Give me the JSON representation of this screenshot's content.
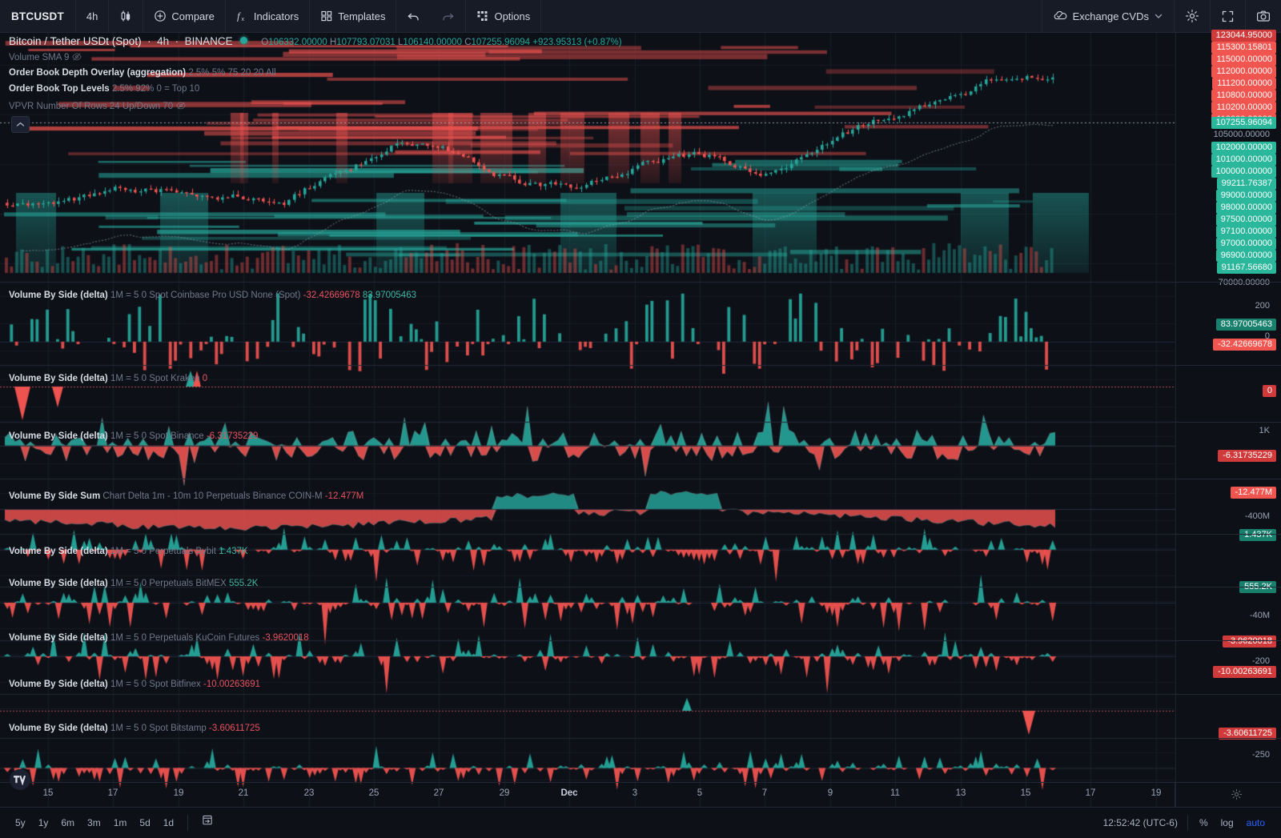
{
  "toolbar": {
    "symbol": "BTCUSDT",
    "interval": "4h",
    "candle_style_icon": "candlestick-icon",
    "compare_label": "Compare",
    "indicators_label": "Indicators",
    "templates_label": "Templates",
    "undo_icon": "undo-icon",
    "redo_icon": "redo-icon",
    "options_label": "Options",
    "layout_label": "Exchange CVDs",
    "layout_icon": "cloud-check-icon",
    "chevron_icon": "chevron-down-icon",
    "settings_icon": "gear-icon",
    "fullscreen_icon": "fullscreen-icon",
    "snapshot_icon": "camera-icon"
  },
  "header": {
    "title": "Bitcoin / Tether USDt (Spot)",
    "interval": "4h",
    "exchange": "BINANCE",
    "status_dot_color": "#26a69a",
    "ohlc": {
      "o_key": "O",
      "o": "106332.00000",
      "h_key": "H",
      "h": "107793.07031",
      "l_key": "L",
      "l": "106140.00000",
      "c_key": "C",
      "c": "107255.96094",
      "change": "+923.95313",
      "change_pct": "(+0.87%)",
      "color": "#26a69a"
    },
    "sublines": [
      {
        "title": "Volume SMA 9",
        "params": "",
        "dim": true,
        "eye": "eye-off-icon"
      },
      {
        "title": "Order Book Depth Overlay (aggregation)",
        "params": "2.5% 5% 75 20 20 All",
        "dim": false,
        "eye": ""
      },
      {
        "title": "Order Book Top Levels",
        "params": "2.5% 92% 0 = Top 10",
        "dim": false,
        "eye": ""
      },
      {
        "title": "VPVR Number Of Rows 24 Up/Down 70",
        "params": "",
        "dim": true,
        "eye": "eye-off-icon"
      }
    ]
  },
  "price_scale": {
    "red_labels": [
      "123044.95000",
      "115300.15801",
      "115000.00000",
      "112000.00000",
      "111200.00000",
      "110800.00000",
      "110200.00000",
      "110000.00000"
    ],
    "current_price": "107255.96094",
    "mid_plain": "105000.00000",
    "green_labels": [
      "102000.00000",
      "101000.00000",
      "100000.00000",
      "99211.76387",
      "99000.00000",
      "98000.00000",
      "97500.00000",
      "97100.00000",
      "97000.00000",
      "96900.00000",
      "91167.56680"
    ],
    "bottom_plain": "70000.00000"
  },
  "panes": [
    {
      "name": "cvd-coinbase",
      "title": "Volume By Side (delta)",
      "params": "1M = 5 0 Spot Coinbase Pro USD None (Spot)",
      "value_neg": "-32.42669678",
      "value_pos": "83.97005463",
      "scale": [
        "200",
        "83.97005463",
        "0",
        "-32.42669678"
      ]
    },
    {
      "name": "cvd-kraken",
      "title": "Volume By Side (delta)",
      "params": "1M = 5 0 Spot Kraken",
      "value_neg": "0",
      "value_pos": "",
      "scale": [
        "0"
      ]
    },
    {
      "name": "cvd-binance",
      "title": "Volume By Side (delta)",
      "params": "1M = 5 0 Spot Binance",
      "value_neg": "-6.31735229",
      "value_pos": "",
      "scale": [
        "1K",
        "-6.31735229"
      ]
    },
    {
      "name": "cvd-sum-binance-coinm",
      "title": "Volume By Side Sum",
      "params": "Chart Delta 1m - 10m 10 Perpetuals Binance COIN-M",
      "value_neg": "-12.477M",
      "value_pos": "",
      "scale": [
        "-12.477M",
        "-400M"
      ]
    },
    {
      "name": "cvd-bybit",
      "title": "Volume By Side (delta)",
      "params": "1M = 5 0 Perpetuals Bybit",
      "value_neg": "",
      "value_pos": "1.437K",
      "scale": [
        "1.437K"
      ]
    },
    {
      "name": "cvd-bitmex",
      "title": "Volume By Side (delta)",
      "params": "1M = 5 0 Perpetuals BitMEX",
      "value_neg": "",
      "value_pos": "555.2K",
      "scale": [
        "555.2K",
        "-40M"
      ]
    },
    {
      "name": "cvd-kucoin",
      "title": "Volume By Side (delta)",
      "params": "1M = 5 0 Perpetuals KuCoin Futures",
      "value_neg": "-3.9620018",
      "value_pos": "",
      "scale": [
        "-3.9620018",
        "-200"
      ]
    },
    {
      "name": "cvd-bitfinex",
      "title": "Volume By Side (delta)",
      "params": "1M = 5 0 Spot Bitfinex",
      "value_neg": "-10.00263691",
      "value_pos": "",
      "scale": [
        "-10.00263691"
      ]
    },
    {
      "name": "cvd-bitstamp",
      "title": "Volume By Side (delta)",
      "params": "1M = 5 0 Spot Bitstamp",
      "value_neg": "-3.60611725",
      "value_pos": "",
      "scale": [
        "-3.60611725",
        "-250"
      ]
    }
  ],
  "time_axis": {
    "ticks": [
      {
        "label": "15",
        "bold": false
      },
      {
        "label": "17",
        "bold": false
      },
      {
        "label": "19",
        "bold": false
      },
      {
        "label": "21",
        "bold": false
      },
      {
        "label": "23",
        "bold": false
      },
      {
        "label": "25",
        "bold": false
      },
      {
        "label": "27",
        "bold": false
      },
      {
        "label": "29",
        "bold": false
      },
      {
        "label": "Dec",
        "bold": true
      },
      {
        "label": "3",
        "bold": false
      },
      {
        "label": "5",
        "bold": false
      },
      {
        "label": "7",
        "bold": false
      },
      {
        "label": "9",
        "bold": false
      },
      {
        "label": "11",
        "bold": false
      },
      {
        "label": "13",
        "bold": false
      },
      {
        "label": "15",
        "bold": false
      },
      {
        "label": "17",
        "bold": false
      },
      {
        "label": "19",
        "bold": false
      }
    ],
    "gear_icon": "gear-icon"
  },
  "bottom_bar": {
    "ranges": [
      "5y",
      "1y",
      "6m",
      "3m",
      "1m",
      "5d",
      "1d"
    ],
    "calendar_icon": "calendar-goto-icon",
    "clock": "12:52:42 (UTC-6)",
    "percent_label": "%",
    "log_label": "log",
    "auto_label": "auto",
    "auto_active": true
  },
  "colors": {
    "up": "#26a69a",
    "down": "#ef5350",
    "bg": "#0d1017",
    "panel": "#161b26",
    "grid": "#181d29",
    "accent": "#2962ff"
  },
  "chart_data": {
    "type": "line",
    "title": "Bitcoin / Tether USDt (Spot) 4h BINANCE",
    "xlabel": "",
    "ylabel": "",
    "ylim": [
      70000,
      123044.95
    ],
    "grid": true,
    "legend": "top-left",
    "notes": "Candlestick chart with Order Book Depth Overlay, VPVR, Volume SMA 9 plus nine Volume-By-Side CVD subpanes."
  }
}
